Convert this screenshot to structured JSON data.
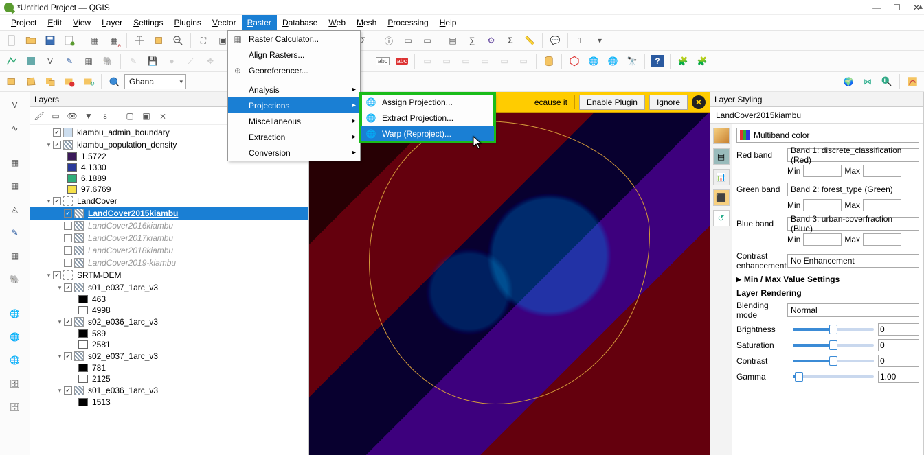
{
  "window": {
    "title": "*Untitled Project — QGIS"
  },
  "menubar": [
    "Project",
    "Edit",
    "View",
    "Layer",
    "Settings",
    "Plugins",
    "Vector",
    "Raster",
    "Database",
    "Web",
    "Mesh",
    "Processing",
    "Help"
  ],
  "menubar_active": "Raster",
  "raster_menu": {
    "items": [
      {
        "label": "Raster Calculator...",
        "icon": "calc"
      },
      {
        "label": "Align Rasters..."
      },
      {
        "label": "Georeferencer...",
        "icon": "georef"
      },
      {
        "sep": true
      },
      {
        "label": "Analysis",
        "sub": true
      },
      {
        "label": "Projections",
        "sub": true,
        "highlight": true
      },
      {
        "label": "Miscellaneous",
        "sub": true
      },
      {
        "label": "Extraction",
        "sub": true
      },
      {
        "label": "Conversion",
        "sub": true
      }
    ]
  },
  "projections_submenu": {
    "items": [
      {
        "label": "Assign Projection...",
        "icon": "globe"
      },
      {
        "label": "Extract Projection...",
        "icon": "globe"
      },
      {
        "label": "Warp (Reproject)...",
        "icon": "warp",
        "highlight": true
      }
    ]
  },
  "toolbar3": {
    "combo": "Ghana"
  },
  "plugin_bar": {
    "text_fragment": "ecause it",
    "enable": "Enable Plugin",
    "ignore": "Ignore"
  },
  "layers_panel": {
    "title": "Layers",
    "tree": [
      {
        "type": "layer",
        "checked": true,
        "label": "kiambu_admin_boundary",
        "icon": "vec",
        "indent": 1
      },
      {
        "type": "group",
        "expanded": true,
        "checked": true,
        "label": "kiambu_population_density",
        "icon": "ras",
        "indent": 1
      },
      {
        "type": "legend",
        "color": "#3b1a5a",
        "label": "1.5722",
        "indent": 3
      },
      {
        "type": "legend",
        "color": "#2a3a9a",
        "label": "4.1330",
        "indent": 3
      },
      {
        "type": "legend",
        "color": "#2fae7a",
        "label": "6.1889",
        "indent": 3
      },
      {
        "type": "legend",
        "color": "#f5e04a",
        "label": "97.6769",
        "indent": 3
      },
      {
        "type": "group",
        "expanded": true,
        "checked": true,
        "label": "LandCover",
        "icon": "grp",
        "indent": 1
      },
      {
        "type": "layer",
        "checked": true,
        "label": "LandCover2015kiambu",
        "icon": "ras",
        "indent": 2,
        "selected": true
      },
      {
        "type": "layer",
        "checked": false,
        "label": "LandCover2016kiambu",
        "icon": "ras",
        "indent": 2,
        "dim": true
      },
      {
        "type": "layer",
        "checked": false,
        "label": "LandCover2017kiambu",
        "icon": "ras",
        "indent": 2,
        "dim": true
      },
      {
        "type": "layer",
        "checked": false,
        "label": "LandCover2018kiambu",
        "icon": "ras",
        "indent": 2,
        "dim": true
      },
      {
        "type": "layer",
        "checked": false,
        "label": "LandCover2019-kiambu",
        "icon": "ras",
        "indent": 2,
        "dim": true
      },
      {
        "type": "group",
        "expanded": true,
        "checked": true,
        "label": "SRTM-DEM",
        "icon": "grp",
        "indent": 1
      },
      {
        "type": "group",
        "expanded": true,
        "checked": true,
        "label": "s01_e037_1arc_v3",
        "icon": "ras",
        "indent": 2
      },
      {
        "type": "legend",
        "color": "#000000",
        "label": "463",
        "indent": 4
      },
      {
        "type": "legend",
        "color": "#ffffff",
        "label": "4998",
        "indent": 4
      },
      {
        "type": "group",
        "expanded": true,
        "checked": true,
        "label": "s02_e036_1arc_v3",
        "icon": "ras",
        "indent": 2
      },
      {
        "type": "legend",
        "color": "#000000",
        "label": "589",
        "indent": 4
      },
      {
        "type": "legend",
        "color": "#ffffff",
        "label": "2581",
        "indent": 4
      },
      {
        "type": "group",
        "expanded": true,
        "checked": true,
        "label": "s02_e037_1arc_v3",
        "icon": "ras",
        "indent": 2
      },
      {
        "type": "legend",
        "color": "#000000",
        "label": "781",
        "indent": 4
      },
      {
        "type": "legend",
        "color": "#ffffff",
        "label": "2125",
        "indent": 4
      },
      {
        "type": "group",
        "expanded": true,
        "checked": true,
        "label": "s01_e036_1arc_v3",
        "icon": "ras",
        "indent": 2
      },
      {
        "type": "legend",
        "color": "#000000",
        "label": "1513",
        "indent": 4
      }
    ]
  },
  "style_panel": {
    "title": "Layer Styling",
    "layer": "LandCover2015kiambu",
    "renderer": "Multiband color",
    "bands": {
      "red": {
        "label": "Red band",
        "value": "Band 1: discrete_classification (Red)"
      },
      "green": {
        "label": "Green band",
        "value": "Band 2: forest_type (Green)"
      },
      "blue": {
        "label": "Blue band",
        "value": "Band 3: urban-coverfraction (Blue)"
      }
    },
    "min_label": "Min",
    "max_label": "Max",
    "contrast": {
      "label": "Contrast enhancement",
      "value": "No Enhancement"
    },
    "minmax_section": "Min / Max Value Settings",
    "rendering_section": "Layer Rendering",
    "blend": {
      "label": "Blending mode",
      "value": "Normal"
    },
    "sliders": {
      "brightness": {
        "label": "Brightness",
        "value": "0"
      },
      "saturation": {
        "label": "Saturation",
        "value": "0"
      },
      "contrast": {
        "label": "Contrast",
        "value": "0"
      },
      "gamma": {
        "label": "Gamma",
        "value": "1.00"
      }
    }
  }
}
